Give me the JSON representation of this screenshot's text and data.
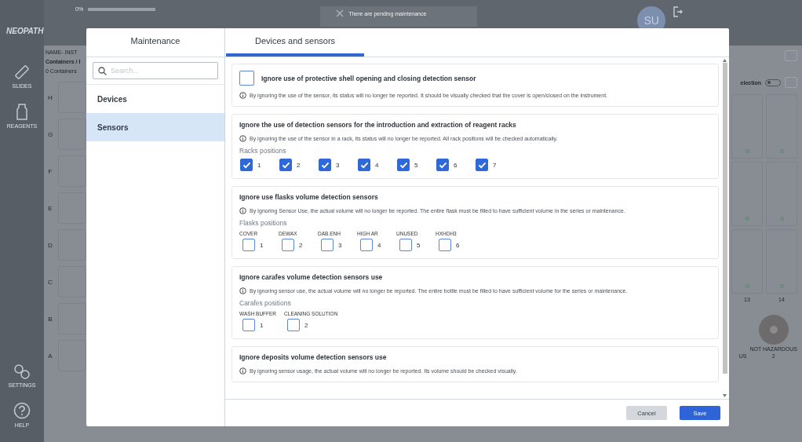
{
  "app": {
    "logo": "NEOPATH",
    "progress": {
      "label": "0%",
      "level": 0
    },
    "notification": "There are pending maintenance",
    "avatar": "SU",
    "nav": [
      {
        "kind": "slides",
        "label": "SLIDES"
      },
      {
        "kind": "reagents",
        "label": "REAGENTS"
      },
      {
        "kind": "settings",
        "label": "SETTINGS"
      },
      {
        "kind": "help",
        "label": "HELP"
      }
    ],
    "instrument_name": "NAME- INST",
    "containers_path": "Containers / I",
    "containers_count": "0 Containers",
    "row_letters": [
      "H",
      "G",
      "F",
      "E",
      "D",
      "C",
      "B",
      "A"
    ],
    "selection_label": "election",
    "selection_toggle": {
      "on": false
    },
    "slot_numbers": [
      "13",
      "14"
    ],
    "legend": [
      {
        "label": "US"
      },
      {
        "label": "NOT HAZARDOUS",
        "count": "2"
      }
    ]
  },
  "dialog": {
    "tabs": [
      {
        "label": "Maintenance",
        "selected": false
      },
      {
        "label": "Devices and sensors",
        "selected": true
      }
    ],
    "search": {
      "placeholder": "Search..."
    },
    "categories": [
      {
        "label": "Devices",
        "selected": false
      },
      {
        "label": "Sensors",
        "selected": true
      }
    ],
    "sections": [
      {
        "title": "Ignore use of protective shell opening and closing detection sensor",
        "checked": false,
        "info": "By ignoring the use of the sensor, its status will no longer be reported. It should be visually checked that the cover is open/closed on the instrument."
      },
      {
        "title": "Ignore the use of detection sensors for the introduction and extraction of reagent racks",
        "info": "By ignoring the use of the sensor in a rack, its status will no longer be reported. All rack positions will be checked automatically.",
        "positions_label": "Racks positions",
        "positions": [
          {
            "number": "1",
            "checked": true
          },
          {
            "number": "2",
            "checked": true
          },
          {
            "number": "3",
            "checked": true
          },
          {
            "number": "4",
            "checked": true
          },
          {
            "number": "5",
            "checked": true
          },
          {
            "number": "6",
            "checked": true
          },
          {
            "number": "7",
            "checked": true
          }
        ]
      },
      {
        "title": "Ignore use flasks volume detection sensors",
        "info": "By Ignoring Sensor Use, the actual volume will no longer be reported. The entire flask must be filled to have sufficient volume in the series or maintenance.",
        "positions_label": "Flasks positions",
        "positions": [
          {
            "name": "COVER",
            "number": "1",
            "checked": false
          },
          {
            "name": "DEWAX",
            "number": "2",
            "checked": false
          },
          {
            "name": "DAB.ENH",
            "number": "3",
            "checked": false
          },
          {
            "name": "HIGH AR",
            "number": "4",
            "checked": false
          },
          {
            "name": "UNUSED",
            "number": "5",
            "checked": false
          },
          {
            "name": "HXHDH3",
            "number": "6",
            "checked": false
          }
        ]
      },
      {
        "title": "Ignore carafes volume detection sensors use",
        "info": "By ignoring sensor use, the actual volume will no longer be reported. The entire bottle must be filled to have sufficient volume for the series or maintenance.",
        "positions_label": "Carafes positions",
        "positions": [
          {
            "name": "WASH BUFFER",
            "number": "1",
            "checked": false
          },
          {
            "name": "CLEANING SOLUTION",
            "number": "2",
            "checked": false
          }
        ]
      },
      {
        "title": "Ignore deposits volume detection sensors use",
        "info": "By ignoring sensor usage, the actual volume will no longer be reported. Its volume should be checked visually."
      }
    ],
    "buttons": [
      {
        "kind": "secondary",
        "label": "Cancel"
      },
      {
        "kind": "primary",
        "label": "Save"
      }
    ]
  }
}
